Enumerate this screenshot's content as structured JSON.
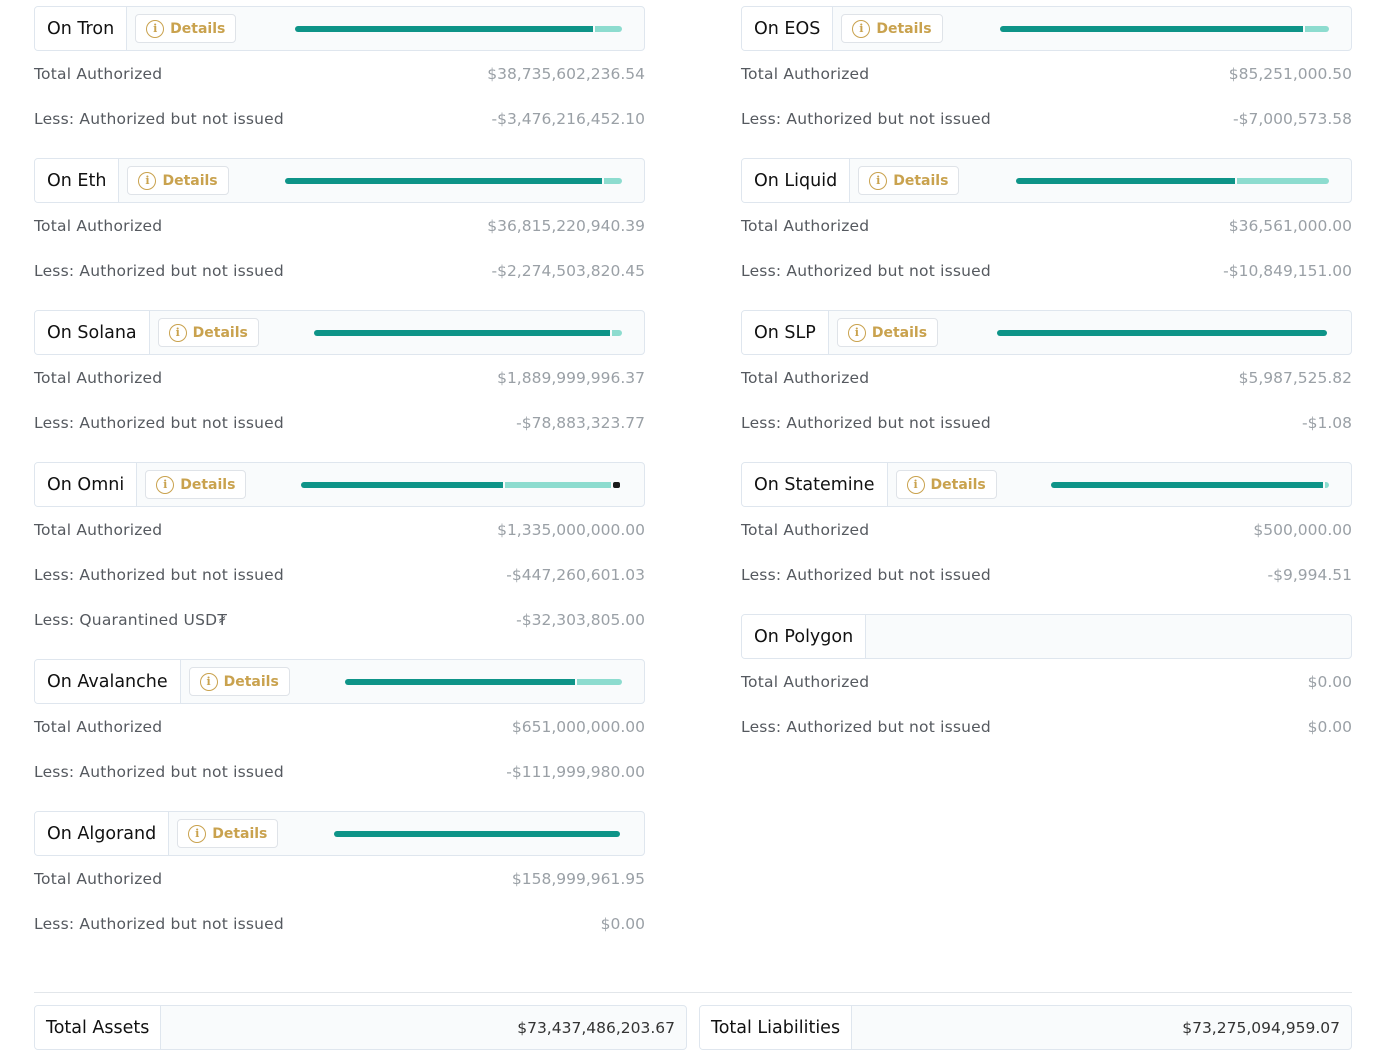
{
  "details_label": "Details",
  "info_icon": "i",
  "colors": {
    "issued": "#0e9488",
    "unissued": "#8ddccf",
    "quarantined": "#1a1a1a",
    "details_gold": "#c9a24e"
  },
  "left_chains": [
    {
      "name": "On Tron",
      "has_details": true,
      "bar": {
        "issued": 0.91,
        "unissued": 0.09
      },
      "rows": [
        {
          "label": "Total Authorized",
          "value": "$38,735,602,236.54"
        },
        {
          "label": "Less: Authorized but not issued",
          "value": "-$3,476,216,452.10"
        }
      ]
    },
    {
      "name": "On Eth",
      "has_details": true,
      "bar": {
        "issued": 0.94,
        "unissued": 0.06
      },
      "rows": [
        {
          "label": "Total Authorized",
          "value": "$36,815,220,940.39"
        },
        {
          "label": "Less: Authorized but not issued",
          "value": "-$2,274,503,820.45"
        }
      ]
    },
    {
      "name": "On Solana",
      "has_details": true,
      "bar": {
        "issued": 0.96,
        "unissued": 0.04
      },
      "rows": [
        {
          "label": "Total Authorized",
          "value": "$1,889,999,996.37"
        },
        {
          "label": "Less: Authorized but not issued",
          "value": "-$78,883,323.77"
        }
      ]
    },
    {
      "name": "On Omni",
      "has_details": true,
      "bar": {
        "issued": 0.63,
        "unissued": 0.33,
        "quarantined": 0.02
      },
      "rows": [
        {
          "label": "Total Authorized",
          "value": "$1,335,000,000.00"
        },
        {
          "label": "Less: Authorized but not issued",
          "value": "-$447,260,601.03"
        },
        {
          "label": "Less: Quarantined USD₮",
          "value": "-$32,303,805.00"
        }
      ]
    },
    {
      "name": "On Avalanche",
      "has_details": true,
      "bar": {
        "issued": 0.83,
        "unissued": 0.17
      },
      "rows": [
        {
          "label": "Total Authorized",
          "value": "$651,000,000.00"
        },
        {
          "label": "Less: Authorized but not issued",
          "value": "-$111,999,980.00"
        }
      ]
    },
    {
      "name": "On Algorand",
      "has_details": true,
      "bar": {
        "issued": 1.0,
        "unissued": 0.0
      },
      "rows": [
        {
          "label": "Total Authorized",
          "value": "$158,999,961.95"
        },
        {
          "label": "Less: Authorized but not issued",
          "value": "$0.00"
        }
      ]
    }
  ],
  "right_chains": [
    {
      "name": "On EOS",
      "has_details": true,
      "bar": {
        "issued": 0.92,
        "unissued": 0.08
      },
      "rows": [
        {
          "label": "Total Authorized",
          "value": "$85,251,000.50"
        },
        {
          "label": "Less: Authorized but not issued",
          "value": "-$7,000,573.58"
        }
      ]
    },
    {
      "name": "On Liquid",
      "has_details": true,
      "bar": {
        "issued": 0.7,
        "unissued": 0.3
      },
      "rows": [
        {
          "label": "Total Authorized",
          "value": "$36,561,000.00"
        },
        {
          "label": "Less: Authorized but not issued",
          "value": "-$10,849,151.00"
        }
      ]
    },
    {
      "name": "On SLP",
      "has_details": true,
      "bar": {
        "issued": 1.0,
        "unissued": 0.0
      },
      "rows": [
        {
          "label": "Total Authorized",
          "value": "$5,987,525.82"
        },
        {
          "label": "Less: Authorized but not issued",
          "value": "-$1.08"
        }
      ]
    },
    {
      "name": "On Statemine",
      "has_details": true,
      "bar": {
        "issued": 0.98,
        "unissued": 0.02
      },
      "rows": [
        {
          "label": "Total Authorized",
          "value": "$500,000.00"
        },
        {
          "label": "Less: Authorized but not issued",
          "value": "-$9,994.51"
        }
      ]
    },
    {
      "name": "On Polygon",
      "has_details": false,
      "rows": [
        {
          "label": "Total Authorized",
          "value": "$0.00"
        },
        {
          "label": "Less: Authorized but not issued",
          "value": "$0.00"
        }
      ]
    }
  ],
  "totals": {
    "assets_label": "Total Assets",
    "assets_value": "$73,437,486,203.67",
    "liabilities_label": "Total Liabilities",
    "liabilities_value": "$73,275,094,959.07"
  }
}
